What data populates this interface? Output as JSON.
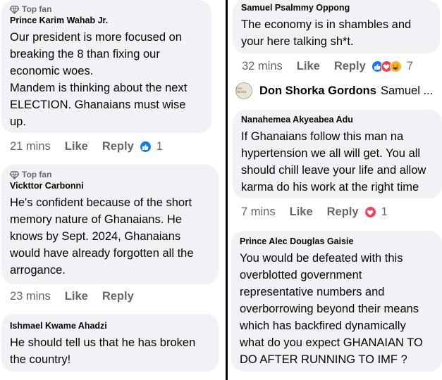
{
  "left": {
    "c1": {
      "badge": "Top fan",
      "author": "Prince Karim Wahab Jr.",
      "text": "Our president is more focused on\nbreaking the 8 than fixing our\neconomic woes.\nMandem is thinking about the next\nELECTION. Ghanaians must wise\nup.",
      "time": "21 mins",
      "like": "Like",
      "reply": "Reply",
      "count": "1"
    },
    "c2": {
      "badge": "Top fan",
      "author": "Vickttor Carbonni",
      "text": "He's confident because of the short\nmemory nature of Ghanaians. He\nknows by Sept. 2024, Ghanaians\nwould have already forgotten all the\narrogance.",
      "time": "23 mins",
      "like": "Like",
      "reply": "Reply"
    },
    "c3": {
      "author": "Ishmael Kwame Ahadzi",
      "text": "He should tell us that he has broken\nthe country!"
    }
  },
  "right": {
    "c1": {
      "author": "Samuel Psalmmy Oppong",
      "text": "The economy is in shambles and\nyour here talking sh*t.",
      "time": "32 mins",
      "like": "Like",
      "reply": "Reply",
      "count": "7"
    },
    "page_reply": {
      "avatar_text": "Don Shorka",
      "name": "Don Shorka Gordons",
      "snippet": "Samuel ..."
    },
    "c2": {
      "author": "Nanahemea Akyeabea Adu",
      "text": "If Ghanaians follow this man na\nhypertension we all will get. You all\nshould chill leave your life and allow\nkarma do his work at the right time",
      "time": "7 mins",
      "like": "Like",
      "reply": "Reply",
      "count": "1"
    },
    "c3": {
      "author": "Prince Alec Douglas Gaisie",
      "text": "You would be defeated with this\noverblotted government\nrepresentative numbers and\noverborrowing beyond their means\nwhich has backfired dynamically\nwhat do you expect GHANAIAN TO\nDO AFTER RUNNING TO IMF ?"
    }
  },
  "colors": {
    "like_blue": "#1877f2",
    "love_red": "#f33e58",
    "haha_yellow": "#f7b125",
    "bubble_bg": "#f0f2f5",
    "meta_gray": "#65676b"
  },
  "icons": {
    "top_fan": "diamond-badge-icon",
    "reactions": [
      "like-reaction-icon",
      "love-reaction-icon",
      "haha-reaction-icon"
    ]
  }
}
